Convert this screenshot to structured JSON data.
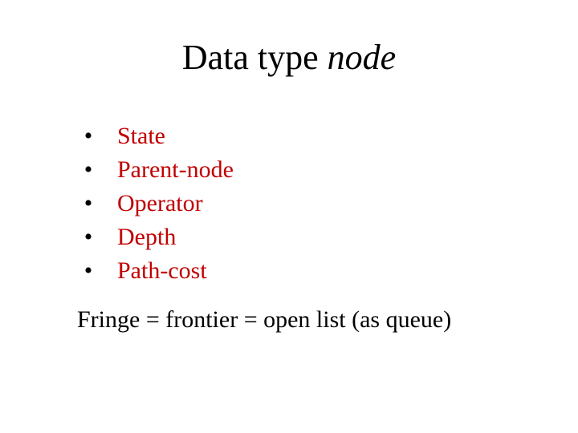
{
  "title": {
    "plain": "Data type ",
    "italic": "node"
  },
  "bullets": [
    "State",
    "Parent-node",
    "Operator",
    "Depth",
    "Path-cost"
  ],
  "footer": "Fringe = frontier = open list (as queue)"
}
